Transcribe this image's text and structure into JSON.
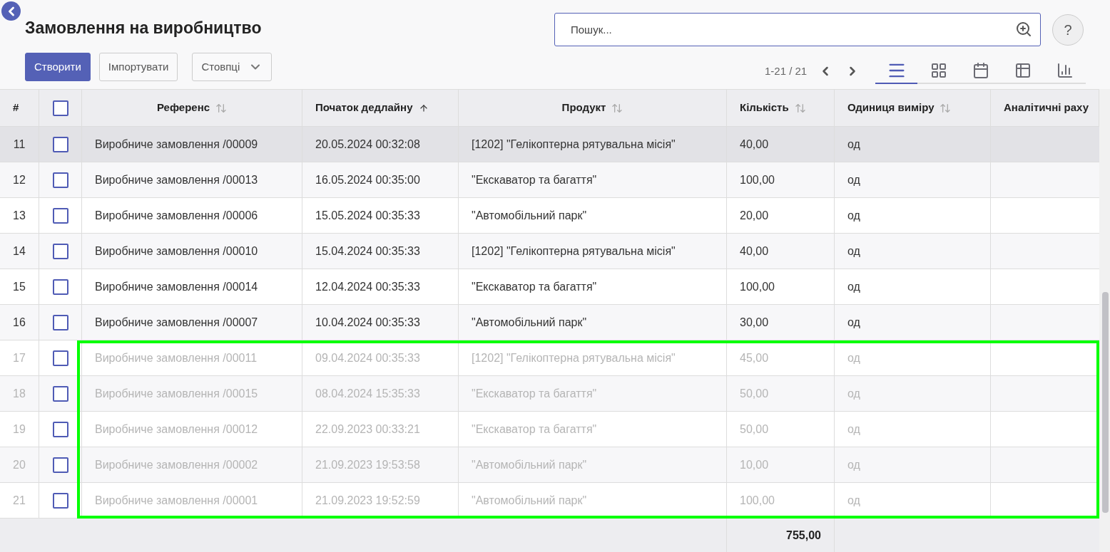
{
  "header": {
    "title": "Замовлення на виробництво",
    "buttons": [
      {
        "label": "Створити",
        "kind": "primary"
      },
      {
        "label": "Імпортувати",
        "kind": "secondary"
      },
      {
        "label": "Стовпці",
        "kind": "dropdown"
      }
    ],
    "search": {
      "placeholder": "Пошук..."
    },
    "help": "?",
    "pager": "1-21 / 21",
    "views": [
      {
        "kind": "list",
        "selected": true
      },
      {
        "kind": "kanban",
        "selected": false
      },
      {
        "kind": "calendar",
        "selected": false
      },
      {
        "kind": "pivot",
        "selected": false
      },
      {
        "kind": "graph",
        "selected": false
      }
    ]
  },
  "table": {
    "all_checked": false,
    "columns": [
      {
        "label": "#",
        "sortable": false,
        "sorted": false
      },
      {
        "label": "Референс",
        "sortable": true,
        "sorted": false
      },
      {
        "label": "Початок дедлайну",
        "sortable": true,
        "sorted": true
      },
      {
        "label": "Продукт",
        "sortable": true,
        "sorted": false
      },
      {
        "label": "Кількість",
        "sortable": true,
        "sorted": false
      },
      {
        "label": "Одиниця виміру",
        "sortable": true,
        "sorted": false
      },
      {
        "label": "Аналітичні раху",
        "sortable": false,
        "sorted": false
      }
    ],
    "rows": [
      {
        "num": "11",
        "checked": false,
        "reference": "Виробниче замовлення /00009",
        "deadline": "20.05.2024 00:32:08",
        "product": "[1202] \"Гелікоптерна рятувальна місія\"",
        "quantity": "40,00",
        "unit": "од",
        "hovered": true,
        "greyed": false,
        "annotated": false
      },
      {
        "num": "12",
        "checked": false,
        "reference": "Виробниче замовлення /00013",
        "deadline": "16.05.2024 00:35:00",
        "product": "\"Екскаватор та багаття\"",
        "quantity": "100,00",
        "unit": "од",
        "hovered": false,
        "greyed": false,
        "annotated": false
      },
      {
        "num": "13",
        "checked": false,
        "reference": "Виробниче замовлення /00006",
        "deadline": "15.05.2024 00:35:33",
        "product": "\"Автомобільний парк\"",
        "quantity": "20,00",
        "unit": "од",
        "hovered": false,
        "greyed": false,
        "annotated": false
      },
      {
        "num": "14",
        "checked": false,
        "reference": "Виробниче замовлення /00010",
        "deadline": "15.04.2024 00:35:33",
        "product": "[1202] \"Гелікоптерна рятувальна місія\"",
        "quantity": "40,00",
        "unit": "од",
        "hovered": false,
        "greyed": false,
        "annotated": false
      },
      {
        "num": "15",
        "checked": false,
        "reference": "Виробниче замовлення /00014",
        "deadline": "12.04.2024 00:35:33",
        "product": "\"Екскаватор та багаття\"",
        "quantity": "100,00",
        "unit": "од",
        "hovered": false,
        "greyed": false,
        "annotated": false
      },
      {
        "num": "16",
        "checked": false,
        "reference": "Виробниче замовлення /00007",
        "deadline": "10.04.2024 00:35:33",
        "product": "\"Автомобільний парк\"",
        "quantity": "30,00",
        "unit": "од",
        "hovered": false,
        "greyed": false,
        "annotated": false
      },
      {
        "num": "17",
        "checked": false,
        "reference": "Виробниче замовлення /00011",
        "deadline": "09.04.2024 00:35:33",
        "product": "[1202] \"Гелікоптерна рятувальна місія\"",
        "quantity": "45,00",
        "unit": "од",
        "hovered": false,
        "greyed": true,
        "annotated": true
      },
      {
        "num": "18",
        "checked": false,
        "reference": "Виробниче замовлення /00015",
        "deadline": "08.04.2024 15:35:33",
        "product": "\"Екскаватор та багаття\"",
        "quantity": "50,00",
        "unit": "од",
        "hovered": false,
        "greyed": true,
        "annotated": true
      },
      {
        "num": "19",
        "checked": false,
        "reference": "Виробниче замовлення /00012",
        "deadline": "22.09.2023 00:33:21",
        "product": "\"Екскаватор та багаття\"",
        "quantity": "50,00",
        "unit": "од",
        "hovered": false,
        "greyed": true,
        "annotated": true
      },
      {
        "num": "20",
        "checked": false,
        "reference": "Виробниче замовлення /00002",
        "deadline": "21.09.2023 19:53:58",
        "product": "\"Автомобільний парк\"",
        "quantity": "10,00",
        "unit": "од",
        "hovered": false,
        "greyed": true,
        "annotated": true
      },
      {
        "num": "21",
        "checked": false,
        "reference": "Виробниче замовлення /00001",
        "deadline": "21.09.2023 19:52:59",
        "product": "\"Автомобільний парк\"",
        "quantity": "100,00",
        "unit": "од",
        "hovered": false,
        "greyed": true,
        "annotated": true
      }
    ],
    "total_quantity": "755,00"
  }
}
